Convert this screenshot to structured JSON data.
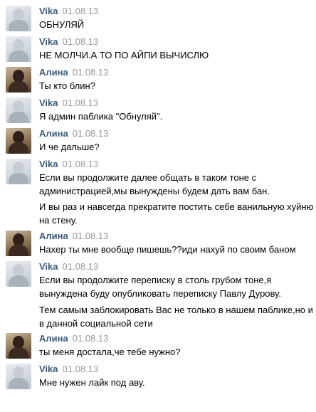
{
  "messages": [
    {
      "author": "Vika",
      "date": "01.08.13",
      "avatar": "vika",
      "lines": [
        "ОБНУЛЯЙ"
      ]
    },
    {
      "author": "Vika",
      "date": "01.08.13",
      "avatar": "vika",
      "lines": [
        "НЕ МОЛЧИ.А ТО ПО АЙПИ ВЫЧИСЛЮ"
      ]
    },
    {
      "author": "Алина",
      "date": "01.08.13",
      "avatar": "alina",
      "lines": [
        "Ты кто блин?"
      ]
    },
    {
      "author": "Vika",
      "date": "01.08.13",
      "avatar": "vika",
      "lines": [
        "Я админ паблика \"Обнуляй\"."
      ]
    },
    {
      "author": "Алина",
      "date": "01.08.13",
      "avatar": "alina",
      "lines": [
        "И че дальше?"
      ]
    },
    {
      "author": "Vika",
      "date": "01.08.13",
      "avatar": "vika",
      "lines": [
        "Если вы продолжите далее общать в таком тоне с",
        "администрацией,мы вынуждены будем дать вам бан.",
        "И вы раз и навсегда прекратите постить себе ванильную хуйню",
        "на стену."
      ]
    },
    {
      "author": "Алина",
      "date": "01.08.13",
      "avatar": "alina",
      "lines": [
        "Нахер ты мне вообще пишешь??иди нахуй по своим баном"
      ]
    },
    {
      "author": "Vika",
      "date": "01.08.13",
      "avatar": "vika",
      "lines": [
        "Если вы продолжите переписку в столь грубом тоне,я",
        "вынуждена буду опубликовать переписку Павлу Дурову.",
        "Тем самым заблокировать Вас не только в нашем паблике,но и",
        "в данной социальной сети"
      ]
    },
    {
      "author": "Алина",
      "date": "01.08.13",
      "avatar": "alina",
      "lines": [
        "ты меня достала,че тебе нужно?"
      ]
    },
    {
      "author": "Vika",
      "date": "01.08.13",
      "avatar": "vika",
      "lines": [
        "Мне нужен лайк под аву."
      ]
    }
  ]
}
